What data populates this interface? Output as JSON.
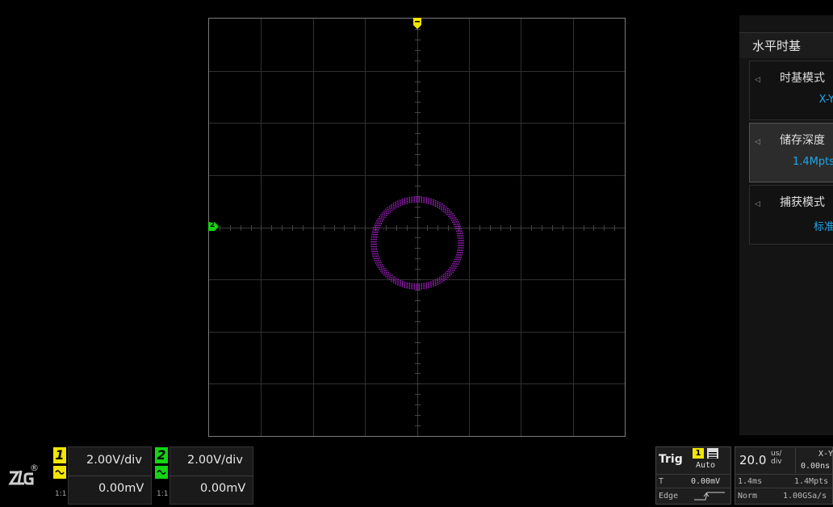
{
  "colors": {
    "ch1": "#f2e500",
    "ch2": "#14d414",
    "trace": "#a020c0",
    "accent": "#1ea7e8"
  },
  "waveform": {
    "mode_display": "X-Y",
    "shape": "circle"
  },
  "markers": {
    "trigger_marker_label": "T",
    "ch2_marker_label": "2"
  },
  "menu": {
    "title": "水平时基",
    "items": [
      {
        "label": "时基模式",
        "value": "X-Y",
        "selected": false
      },
      {
        "label": "储存深度",
        "value": "1.4Mpts",
        "selected": true
      },
      {
        "label": "捕获模式",
        "value": "标准",
        "selected": false
      }
    ]
  },
  "brand": {
    "logo_text": "ZLG",
    "registered_mark": "®"
  },
  "channels": [
    {
      "number": "1",
      "scale": "2.00V/div",
      "offset": "0.00mV",
      "probe": "1:1",
      "coupling_icon": "ac-coupling-icon"
    },
    {
      "number": "2",
      "scale": "2.00V/div",
      "offset": "0.00mV",
      "probe": "1:1",
      "coupling_icon": "ac-coupling-icon"
    }
  ],
  "trigger": {
    "label": "Trig",
    "source": "1",
    "mode": "Auto",
    "level_label": "T",
    "level": "0.00mV",
    "type": "Edge",
    "slope_icon": "rising-edge-icon"
  },
  "timebase": {
    "scale_value": "20.0",
    "scale_unit_top": "us/",
    "scale_unit_bottom": "div",
    "mode": "X-Y",
    "delay": "0.00ns",
    "span": "1.4ms",
    "depth": "1.4Mpts",
    "acq_mode": "Norm",
    "sample_rate": "1.00GSa/s"
  }
}
